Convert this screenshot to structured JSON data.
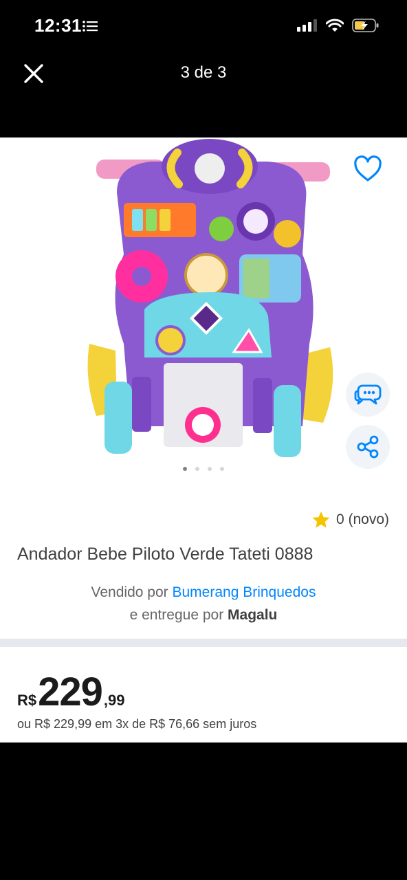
{
  "status_bar": {
    "time": "12:31"
  },
  "nav": {
    "title": "3 de 3"
  },
  "gallery": {
    "dots": 4,
    "active_dot": 0
  },
  "rating": {
    "text": "0 (novo)"
  },
  "product": {
    "title": "Andador Bebe Piloto Verde Tateti 0888"
  },
  "seller": {
    "prefix": "Vendido por",
    "name": "Bumerang Brinquedos",
    "delivery_prefix": "e entregue por",
    "delivery_name": "Magalu"
  },
  "price": {
    "currency": "R$",
    "integer": "229",
    "cents": ",99",
    "installments": "ou R$ 229,99 em 3x de R$ 76,66 sem juros"
  },
  "colors": {
    "accent": "#0086ff",
    "star": "#f5c400",
    "divider": "#e5e8ec",
    "text": "#404040"
  }
}
